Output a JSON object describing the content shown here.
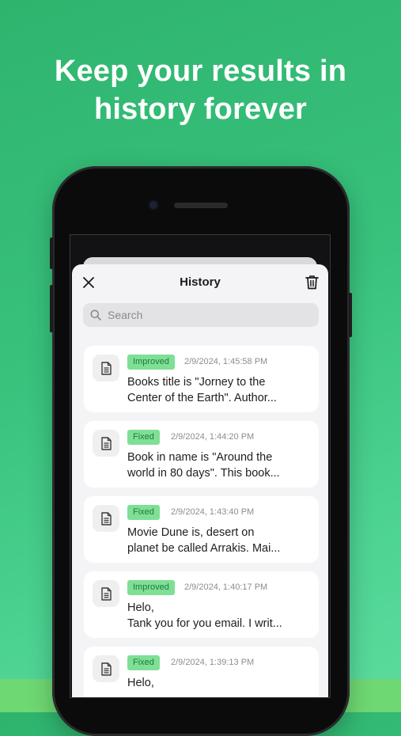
{
  "headline": {
    "line1": "Keep your results in",
    "line2": "history forever"
  },
  "sheet": {
    "title": "History",
    "search_placeholder": "Search"
  },
  "icons": {
    "close": "close-icon",
    "trash": "trash-icon",
    "search": "search-icon",
    "document": "document-icon"
  },
  "colors": {
    "background_green": "#38c27c",
    "badge_bg": "#7fdf95",
    "badge_text": "#1d7a3e"
  },
  "items": [
    {
      "badge": "Improved",
      "date": "2/9/2024, 1:45:58 PM",
      "line1": "Books title is \"Jorney to the",
      "line2": "Center of the Earth\". Author..."
    },
    {
      "badge": "Fixed",
      "date": "2/9/2024, 1:44:20 PM",
      "line1": "Book in name is \"Around the",
      "line2": "world in 80 days\". This book..."
    },
    {
      "badge": "Fixed",
      "date": "2/9/2024, 1:43:40 PM",
      "line1": "Movie Dune is, desert on",
      "line2": "planet be called Arrakis. Mai..."
    },
    {
      "badge": "Improved",
      "date": "2/9/2024, 1:40:17 PM",
      "line1": "Helo,",
      "line2": "Tank you for you email. I writ..."
    },
    {
      "badge": "Fixed",
      "date": "2/9/2024, 1:39:13 PM",
      "line1": "Helo,",
      "line2": ""
    }
  ]
}
